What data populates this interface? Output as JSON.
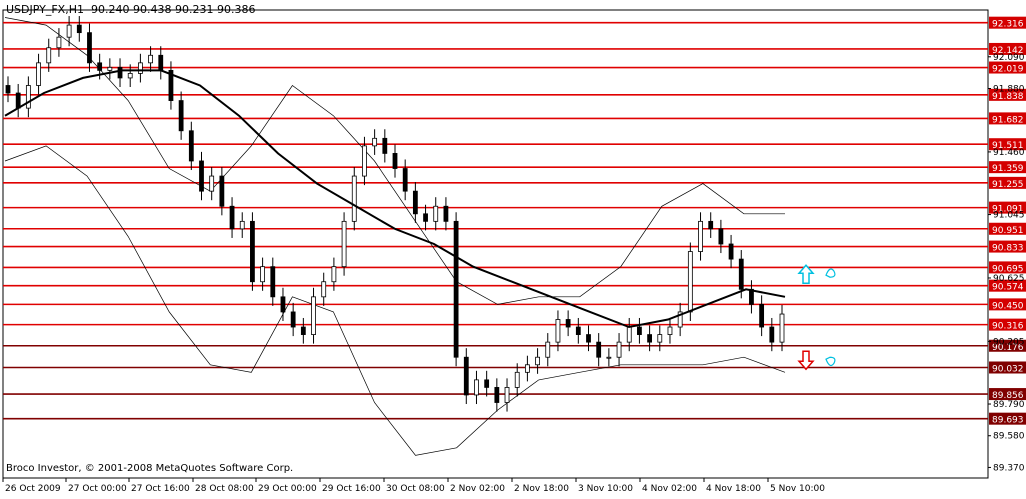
{
  "header": {
    "symbol": "USDJPY_FX,H1",
    "ohlc": "90.240 90.438 90.231 90.386"
  },
  "footer": {
    "copyright": "Broco Investor, © 2001-2008 MetaQuotes Software Corp."
  },
  "colors": {
    "background": "#ffffff",
    "level_red": "#e00000",
    "level_dark": "#800000",
    "price_tag_bg": "#d40000",
    "candles": "#000000",
    "moving_average": "#000000",
    "arrow_up": "#00c0e0",
    "arrow_down": "#e00000"
  },
  "chart_data": {
    "type": "candlestick",
    "symbol": "USDJPY_FX",
    "timeframe": "H1",
    "ylim": [
      89.3,
      92.4
    ],
    "x_tick_labels": [
      "26 Oct 2009",
      "27 Oct 00:00",
      "27 Oct 16:00",
      "28 Oct 08:00",
      "29 Oct 00:00",
      "29 Oct 16:00",
      "30 Oct 08:00",
      "2 Nov 02:00",
      "2 Nov 18:00",
      "3 Nov 10:00",
      "4 Nov 02:00",
      "4 Nov 18:00",
      "5 Nov 10:00"
    ],
    "y_tick_labels": [
      92.09,
      91.88,
      91.46,
      91.045,
      90.625,
      90.205,
      89.79,
      89.58,
      89.37
    ],
    "current_price": 90.386,
    "horizontal_levels": [
      {
        "value": 92.316,
        "label": "92.316",
        "color": "red"
      },
      {
        "value": 92.142,
        "label": "92.142",
        "color": "red"
      },
      {
        "value": 92.019,
        "label": "92.019",
        "color": "red"
      },
      {
        "value": 91.838,
        "label": "91.838",
        "color": "red"
      },
      {
        "value": 91.682,
        "label": "91.682",
        "color": "red"
      },
      {
        "value": 91.511,
        "label": "91.511",
        "color": "red"
      },
      {
        "value": 91.359,
        "label": "91.359",
        "color": "red"
      },
      {
        "value": 91.255,
        "label": "91.255",
        "color": "red"
      },
      {
        "value": 91.091,
        "label": "91.091",
        "color": "red"
      },
      {
        "value": 90.951,
        "label": "90.951",
        "color": "red"
      },
      {
        "value": 90.833,
        "label": "90.833",
        "color": "red"
      },
      {
        "value": 90.695,
        "label": "90.695",
        "color": "red"
      },
      {
        "value": 90.574,
        "label": "90.574",
        "color": "red"
      },
      {
        "value": 90.45,
        "label": "90.450",
        "color": "red"
      },
      {
        "value": 90.316,
        "label": "90.316",
        "color": "red"
      },
      {
        "value": 90.176,
        "label": "90.176",
        "color": "dark"
      },
      {
        "value": 90.032,
        "label": "90.032",
        "color": "dark"
      },
      {
        "value": 89.856,
        "label": "89.856",
        "color": "dark"
      },
      {
        "value": 89.693,
        "label": "89.693",
        "color": "dark"
      }
    ],
    "closes": [
      91.85,
      91.75,
      91.9,
      92.05,
      92.15,
      92.22,
      92.3,
      92.25,
      92.05,
      92.0,
      92.02,
      91.95,
      91.98,
      92.05,
      92.1,
      92.0,
      91.8,
      91.6,
      91.4,
      91.2,
      91.3,
      91.1,
      90.95,
      91.0,
      90.6,
      90.7,
      90.5,
      90.4,
      90.3,
      90.25,
      90.5,
      90.6,
      90.7,
      91.0,
      91.3,
      91.5,
      91.55,
      91.45,
      91.35,
      91.2,
      91.05,
      91.0,
      91.1,
      91.0,
      90.1,
      89.85,
      89.95,
      89.9,
      89.8,
      89.9,
      90.0,
      90.05,
      90.1,
      90.2,
      90.35,
      90.3,
      90.25,
      90.2,
      90.1,
      90.1,
      90.2,
      90.3,
      90.25,
      90.2,
      90.25,
      90.3,
      90.4,
      90.8,
      91.0,
      90.95,
      90.85,
      90.75,
      90.55,
      90.45,
      90.3,
      90.2,
      90.386
    ],
    "moving_average": [
      91.7,
      91.85,
      91.95,
      92.0,
      92.0,
      91.9,
      91.7,
      91.45,
      91.25,
      91.1,
      90.95,
      90.85,
      90.7,
      90.6,
      90.5,
      90.4,
      90.3,
      90.35,
      90.45,
      90.55,
      90.5
    ],
    "bollinger_upper": [
      92.35,
      92.3,
      92.1,
      91.8,
      91.35,
      91.2,
      91.5,
      91.9,
      91.7,
      91.4,
      91.0,
      90.6,
      90.45,
      90.5,
      90.5,
      90.7,
      91.1,
      91.25,
      91.05,
      91.05
    ],
    "bollinger_lower": [
      91.4,
      91.5,
      91.3,
      90.9,
      90.4,
      90.05,
      90.0,
      90.5,
      90.4,
      89.8,
      89.45,
      89.5,
      89.75,
      89.95,
      90.0,
      90.05,
      90.05,
      90.05,
      90.1,
      90.0
    ],
    "signals": [
      {
        "type": "up",
        "value": 90.63
      },
      {
        "type": "down",
        "value": 90.1
      }
    ]
  }
}
